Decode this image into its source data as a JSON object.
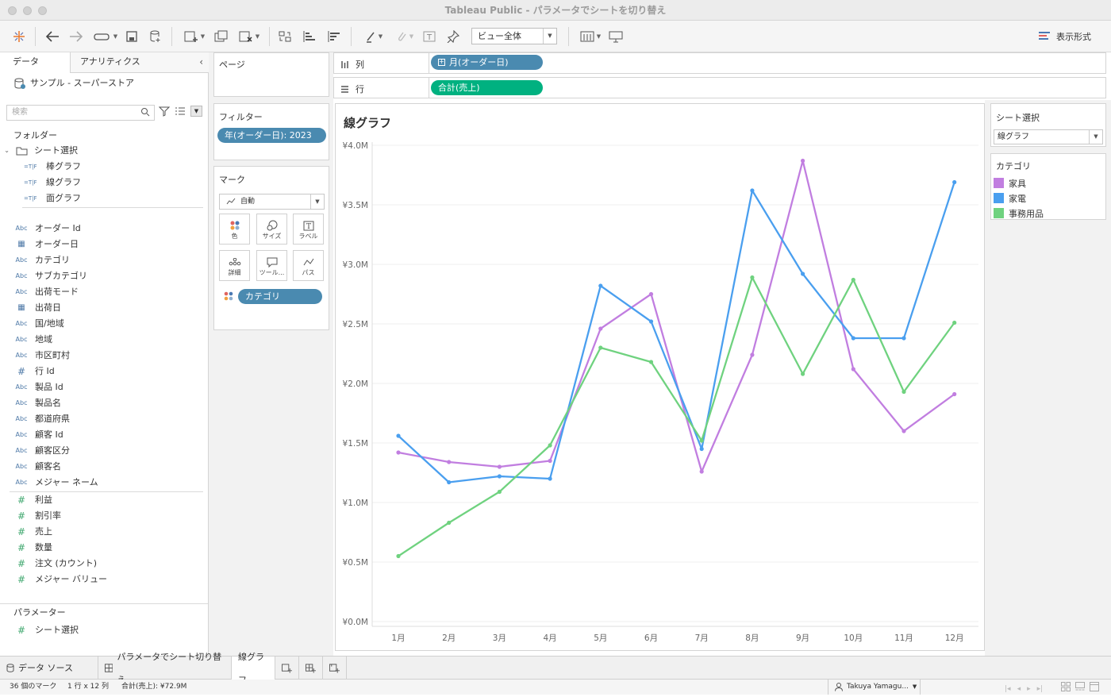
{
  "window": {
    "title": "Tableau Public - パラメータでシートを切り替え"
  },
  "toolbar": {
    "view_select": "ビュー全体",
    "show_me": "表示形式"
  },
  "data_pane": {
    "tab_data": "データ",
    "tab_analytics": "アナリティクス",
    "datasource": "サンプル - スーパーストア",
    "search_placeholder": "検索",
    "folders_header": "フォルダー",
    "folder_name": "シート選択",
    "folder_items": [
      "棒グラフ",
      "線グラフ",
      "面グラフ"
    ],
    "calc_icon": "=T|F",
    "dimensions": [
      {
        "type": "Abc",
        "name": "オーダー Id"
      },
      {
        "type": "date",
        "name": "オーダー日"
      },
      {
        "type": "Abc",
        "name": "カテゴリ"
      },
      {
        "type": "Abc",
        "name": "サブカテゴリ"
      },
      {
        "type": "Abc",
        "name": "出荷モード"
      },
      {
        "type": "date",
        "name": "出荷日"
      },
      {
        "type": "Abc",
        "name": "国/地域"
      },
      {
        "type": "Abc",
        "name": "地域"
      },
      {
        "type": "Abc",
        "name": "市区町村"
      },
      {
        "type": "#",
        "name": "行 Id"
      },
      {
        "type": "Abc",
        "name": "製品 Id"
      },
      {
        "type": "Abc",
        "name": "製品名"
      },
      {
        "type": "Abc",
        "name": "都道府県"
      },
      {
        "type": "Abc",
        "name": "顧客 Id"
      },
      {
        "type": "Abc",
        "name": "顧客区分"
      },
      {
        "type": "Abc",
        "name": "顧客名"
      },
      {
        "type": "Abc",
        "name": "メジャー ネーム"
      }
    ],
    "measures": [
      "利益",
      "割引率",
      "売上",
      "数量",
      "注文 (カウント)",
      "メジャー バリュー"
    ],
    "parameters_header": "パラメーター",
    "parameters": [
      "シート選択"
    ]
  },
  "cards": {
    "pages": "ページ",
    "filters": "フィルター",
    "filter_pill": "年(オーダー日): 2023",
    "marks": "マーク",
    "mark_type": "自動",
    "mark_buttons": [
      "色",
      "サイズ",
      "ラベル",
      "詳細",
      "ツール...",
      "パス"
    ],
    "mark_pill": "カテゴリ"
  },
  "shelves": {
    "columns_label": "列",
    "columns_pill": "月(オーダー日)",
    "rows_label": "行",
    "rows_pill": "合計(売上)"
  },
  "right_pane": {
    "param_title": "シート選択",
    "param_value": "線グラフ",
    "legend_title": "カテゴリ",
    "legend": [
      {
        "name": "家具",
        "color": "#c17ee0"
      },
      {
        "name": "家電",
        "color": "#4a9fef"
      },
      {
        "name": "事務用品",
        "color": "#6fd27f"
      }
    ]
  },
  "chart_data": {
    "type": "line",
    "title": "線グラフ",
    "categories": [
      "1月",
      "2月",
      "3月",
      "4月",
      "5月",
      "6月",
      "7月",
      "8月",
      "9月",
      "10月",
      "11月",
      "12月"
    ],
    "y_ticks": [
      "¥0.0M",
      "¥0.5M",
      "¥1.0M",
      "¥1.5M",
      "¥2.0M",
      "¥2.5M",
      "¥3.0M",
      "¥3.5M",
      "¥4.0M"
    ],
    "ylim": [
      0,
      4.0
    ],
    "grid": true,
    "series": [
      {
        "name": "家具",
        "color": "#c17ee0",
        "values": [
          1.42,
          1.34,
          1.3,
          1.35,
          2.46,
          2.75,
          1.26,
          2.24,
          3.87,
          2.12,
          1.6,
          1.91
        ]
      },
      {
        "name": "家電",
        "color": "#4a9fef",
        "values": [
          1.56,
          1.17,
          1.22,
          1.2,
          2.82,
          2.52,
          1.45,
          3.62,
          2.92,
          2.38,
          2.38,
          3.69
        ]
      },
      {
        "name": "事務用品",
        "color": "#6fd27f",
        "values": [
          0.55,
          0.83,
          1.09,
          1.48,
          2.3,
          2.18,
          1.52,
          2.89,
          2.08,
          2.87,
          1.93,
          2.51
        ]
      }
    ]
  },
  "sheetbar": {
    "datasource_tab": "データ ソース",
    "dashboard_tab": "パラメータでシート切り替え",
    "sheet_tab": "線グラフ"
  },
  "status": {
    "marks": "36 個のマーク",
    "dims": "1 行 x 12 列",
    "sum": "合計(売上): ¥72.9M",
    "user": "Takuya Yamagu..."
  }
}
